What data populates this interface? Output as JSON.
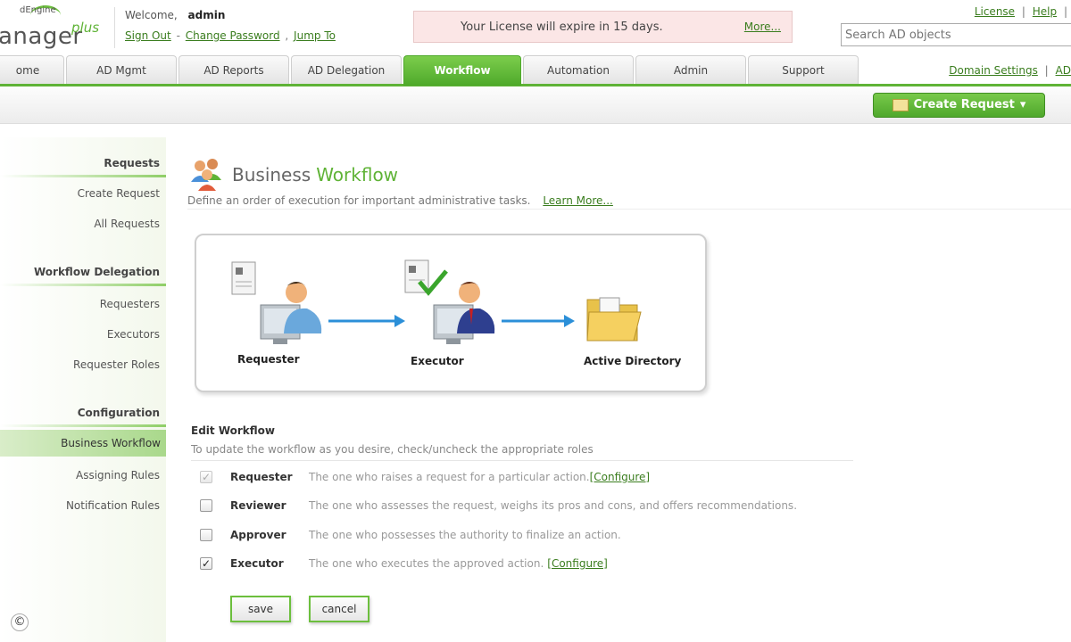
{
  "header": {
    "logo_engine": "dEngine",
    "logo_name": "anager",
    "logo_plus": "plus",
    "welcome_label": "Welcome,",
    "username": "admin",
    "sign_out": "Sign Out",
    "change_password": "Change Password",
    "jump_to": "Jump To",
    "license_message": "Your License will expire in 15 days.",
    "license_more": "More...",
    "top_links": [
      "License",
      "Help"
    ],
    "search_placeholder": "Search AD objects"
  },
  "tabs": [
    {
      "label": "ome",
      "active": false
    },
    {
      "label": "AD Mgmt",
      "active": false
    },
    {
      "label": "AD Reports",
      "active": false
    },
    {
      "label": "AD Delegation",
      "active": false
    },
    {
      "label": "Workflow",
      "active": true
    },
    {
      "label": "Automation",
      "active": false
    },
    {
      "label": "Admin",
      "active": false
    },
    {
      "label": "Support",
      "active": false
    }
  ],
  "tab_right_links": [
    "Domain Settings",
    "AD"
  ],
  "toolbar": {
    "create_request": "Create Request"
  },
  "sidebar": {
    "sections": [
      {
        "title": "Requests",
        "items": [
          "Create Request",
          "All Requests"
        ]
      },
      {
        "title": "Workflow Delegation",
        "items": [
          "Requesters",
          "Executors",
          "Requester Roles"
        ]
      },
      {
        "title": "Configuration",
        "items": [
          "Business Workflow",
          "Assigning Rules",
          "Notification Rules"
        ]
      }
    ],
    "active_item": "Business Workflow"
  },
  "page": {
    "title_part1": "Business",
    "title_part2": "Workflow",
    "description": "Define an order of execution for important administrative tasks.",
    "learn_more": "Learn More..."
  },
  "diagram": {
    "nodes": [
      "Requester",
      "Executor",
      "Active Directory"
    ]
  },
  "edit": {
    "title": "Edit Workflow",
    "description": "To update the workflow as you desire, check/uncheck the appropriate roles",
    "roles": [
      {
        "name": "Requester",
        "description": "The one who raises a request for a particular action.",
        "link": "[Configure]",
        "checked": true,
        "disabled": true
      },
      {
        "name": "Reviewer",
        "description": "The one who assesses the request, weighs its pros and cons, and offers recommendations.",
        "link": "",
        "checked": false,
        "disabled": false
      },
      {
        "name": "Approver",
        "description": "The one who possesses the authority to finalize an action.",
        "link": "",
        "checked": false,
        "disabled": false
      },
      {
        "name": "Executor",
        "description": "The one who executes the approved action.",
        "link": "[Configure]",
        "checked": true,
        "disabled": false
      }
    ],
    "save_label": "save",
    "cancel_label": "cancel"
  },
  "footer": {
    "copyright_symbol": "©"
  },
  "colors": {
    "accent_green": "#5fb336",
    "license_bg": "#fbe6e6"
  }
}
